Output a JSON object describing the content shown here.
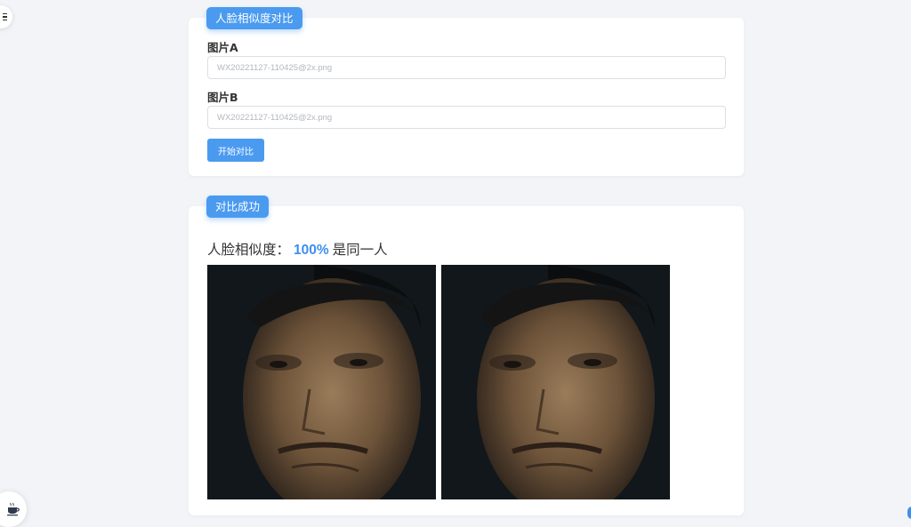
{
  "form_card": {
    "tag": "人脸相似度对比",
    "image_a": {
      "label": "图片A",
      "placeholder": "WX20221127-110425@2x.png"
    },
    "image_b": {
      "label": "图片B",
      "placeholder": "WX20221127-110425@2x.png"
    },
    "compare_button": "开始对比"
  },
  "result_card": {
    "tag": "对比成功",
    "similarity_label": "人脸相似度：",
    "similarity_value": "100%",
    "verdict": "是同一人"
  },
  "colors": {
    "accent": "#4a9af0",
    "highlight": "#3d8ff0",
    "background": "#f2f4f8"
  },
  "icons": {
    "menu": "menu-icon",
    "coffee": "coffee-icon"
  }
}
